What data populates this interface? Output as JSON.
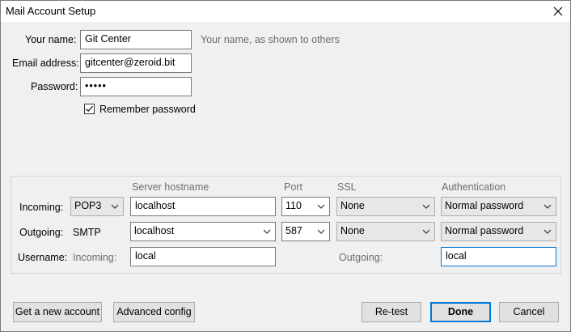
{
  "window": {
    "title": "Mail Account Setup"
  },
  "identity": {
    "name_label": "Your name:",
    "name_value": "Git Center",
    "name_hint": "Your name, as shown to others",
    "email_label": "Email address:",
    "email_value": "gitcenter@zeroid.bit",
    "password_label": "Password:",
    "password_value": "•••••",
    "remember_label": "Remember password",
    "remember_checked": true
  },
  "server": {
    "headers": {
      "hostname": "Server hostname",
      "port": "Port",
      "ssl": "SSL",
      "auth": "Authentication"
    },
    "incoming": {
      "label": "Incoming:",
      "protocol": "POP3",
      "hostname": "localhost",
      "port": "110",
      "ssl": "None",
      "auth": "Normal password"
    },
    "outgoing": {
      "label": "Outgoing:",
      "protocol": "SMTP",
      "hostname": "localhost",
      "port": "587",
      "ssl": "None",
      "auth": "Normal password"
    },
    "username": {
      "label": "Username:",
      "incoming_label": "Incoming:",
      "incoming_value": "local",
      "outgoing_label": "Outgoing:",
      "outgoing_value": "local"
    }
  },
  "buttons": {
    "new_account": "Get a new account",
    "advanced": "Advanced config",
    "retest": "Re-test",
    "done": "Done",
    "cancel": "Cancel"
  },
  "icons": {
    "close": "close-icon",
    "checkmark": "checkmark-icon",
    "dropdown": "chevron-down-icon"
  },
  "colors": {
    "focus": "#0078d7",
    "hint_text": "#6d6d6d"
  }
}
